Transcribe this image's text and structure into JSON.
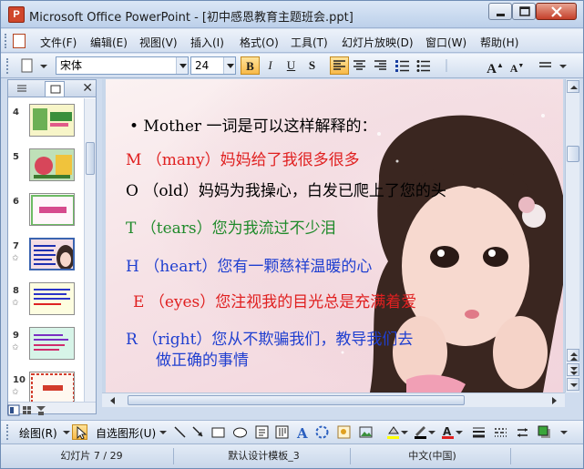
{
  "window": {
    "title": "Microsoft Office PowerPoint - [初中感恩教育主题班会.ppt]",
    "app_icon_letter": "P"
  },
  "menu": {
    "items": [
      "文件(F)",
      "编辑(E)",
      "视图(V)",
      "插入(I)",
      "格式(O)",
      "工具(T)",
      "幻灯片放映(D)",
      "窗口(W)",
      "帮助(H)"
    ]
  },
  "toolbar": {
    "font_name": "宋体",
    "font_size": "24",
    "bold_label": "B",
    "italic_label": "I",
    "underline_label": "U",
    "shadow_label": "S",
    "grow_font_label": "A",
    "shrink_font_label": "A"
  },
  "thumbnails": [
    {
      "number": "4",
      "colors": [
        "#f7f5c8",
        "#3a8f3c"
      ],
      "has_animation": false
    },
    {
      "number": "5",
      "colors": [
        "#bfe0b8",
        "#d7465a"
      ],
      "has_animation": false
    },
    {
      "number": "6",
      "colors": [
        "#fff6fb",
        "#d64b8e"
      ],
      "has_animation": false
    },
    {
      "number": "7",
      "colors": [
        "#f4dde3",
        "#1d2fb0"
      ],
      "has_animation": true,
      "selected": true
    },
    {
      "number": "8",
      "colors": [
        "#fdfde0",
        "#2a34c8"
      ],
      "has_animation": true
    },
    {
      "number": "9",
      "colors": [
        "#d7f4e8",
        "#7a2fc2"
      ],
      "has_animation": true
    },
    {
      "number": "10",
      "colors": [
        "#fff8f0",
        "#d23b2b"
      ],
      "has_animation": true
    }
  ],
  "slide": {
    "lines": [
      {
        "text": "• Mother 一词是可以这样解释的：",
        "color": "#000000"
      },
      {
        "text": "M （many）妈妈给了我很多很多",
        "color": "#e02020"
      },
      {
        "text": "O （old）妈妈为我操心，白发已爬上了您的头",
        "color": "#000000"
      },
      {
        "text": "T （tears）您为我流过不少泪",
        "color": "#1f8a2a"
      },
      {
        "text": "H （heart）您有一颗慈祥温暖的心",
        "color": "#1f3fd0"
      },
      {
        "text": "E （eyes）您注视我的目光总是充满着爱",
        "color": "#e02020"
      },
      {
        "text": "R （right）您从不欺骗我们，教导我们去",
        "color": "#1f3fd0"
      },
      {
        "text": "做正确的事情",
        "color": "#1f3fd0"
      }
    ]
  },
  "drawbar": {
    "draw_label": "绘图(R)",
    "autoshape_label": "自选图形(U)"
  },
  "status": {
    "slide_indicator": "幻灯片 7 / 29",
    "design_template": "默认设计模板_3",
    "language": "中文(中国)"
  }
}
